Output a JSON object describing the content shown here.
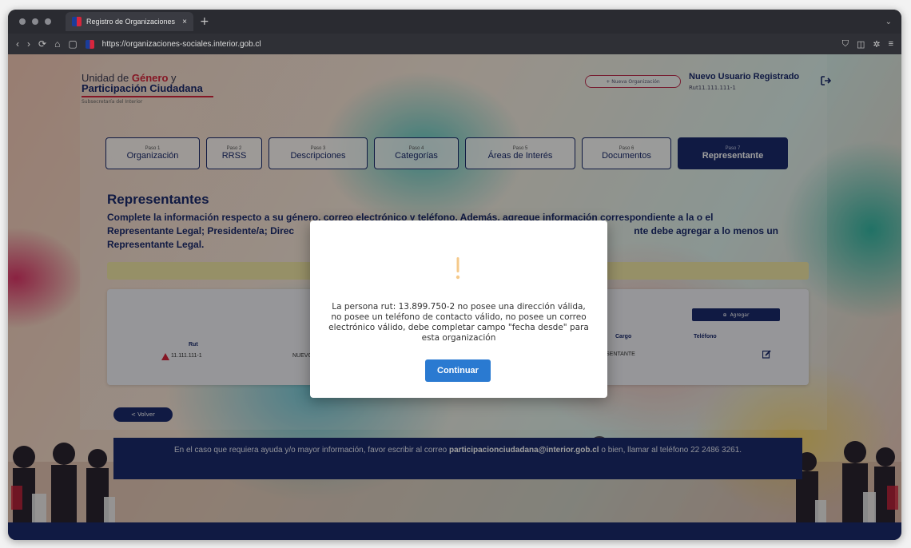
{
  "browser": {
    "tab_title": "Registro de Organizaciones",
    "tab_close": "×",
    "new_tab": "+",
    "url": "https://organizaciones-sociales.interior.gob.cl"
  },
  "header": {
    "logo_line1_prefix": "Unidad de ",
    "logo_line1_bold": "Género",
    "logo_line1_suffix": " y",
    "logo_line2": "Participación Ciudadana",
    "logo_sub": "Subsecretaría del Interior",
    "new_org_button": "+ Nueva Organización",
    "user_name": "Nuevo Usuario Registrado",
    "user_rut": "Rut11.111.111-1"
  },
  "steps": [
    {
      "num": "Paso 1",
      "label": "Organización",
      "active": false
    },
    {
      "num": "Paso 2",
      "label": "RRSS",
      "active": false
    },
    {
      "num": "Paso 3",
      "label": "Descripciones",
      "active": false
    },
    {
      "num": "Paso 4",
      "label": "Categorías",
      "active": false
    },
    {
      "num": "Paso 5",
      "label": "Áreas de Interés",
      "active": false
    },
    {
      "num": "Paso 6",
      "label": "Documentos",
      "active": false
    },
    {
      "num": "Paso 7",
      "label": "Representante",
      "active": true
    }
  ],
  "section": {
    "title": "Representantes",
    "description_visible_1": "Complete la información respecto a su género, correo electrónico y teléfono. Además, agregue información correspondiente a la o el",
    "description_visible_2": "Representante Legal; Presidente/a; Direc",
    "description_visible_3": "nte debe agregar a lo menos un",
    "description_visible_4": "Representante Legal."
  },
  "table": {
    "add_button": "Agregar",
    "headers": {
      "rut": "Rut",
      "cargo": "Cargo",
      "telefono": "Teléfono"
    },
    "row": {
      "rut": "11.111.111-1",
      "nombre": "NUEVO",
      "cargo": "SENTANTE"
    }
  },
  "back_button": "< Volver",
  "footer": {
    "text_before": "En el caso que requiera ayuda y/o mayor información, favor escribir al correo ",
    "email": "participacionciudadana@interior.gob.cl",
    "text_after": " o bien, llamar al teléfono 22 2486 3261."
  },
  "modal": {
    "message": "La persona rut: 13.899.750-2 no posee una dirección válida, no posee un teléfono de contacto válido, no posee un correo electrónico válido, debe completar campo \"fecha desde\" para esta organización",
    "continue_button": "Continuar"
  },
  "colors": {
    "primary_navy": "#1a2a6c",
    "accent_red": "#d7263d",
    "modal_button": "#2a7ad1",
    "warning_icon": "#f5c98a",
    "alert_bar": "#f3e9a6"
  }
}
